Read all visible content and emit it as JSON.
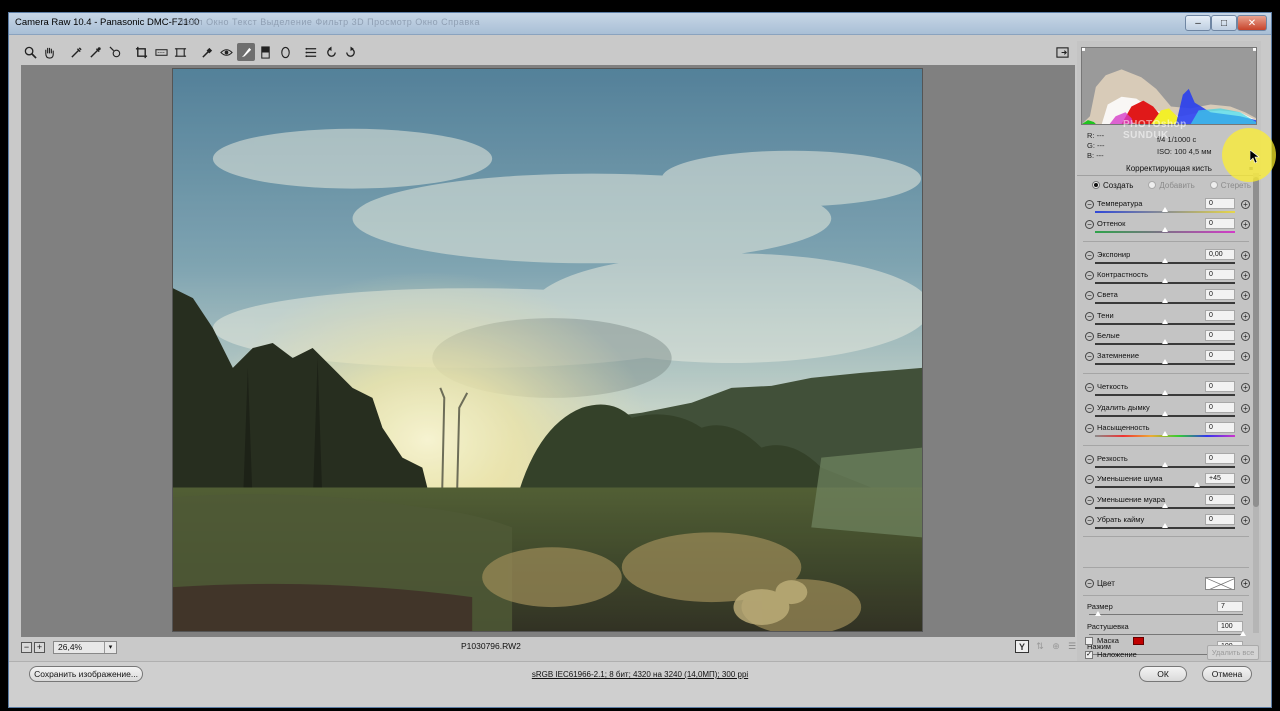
{
  "window": {
    "title": "Camera Raw 10.4  -  Panasonic DMC-FZ100",
    "ghost_menu": "Файл   Окно   Текст   Выделение   Фильтр   3D   Просмотр   Окно   Справка",
    "minimize_label": "–",
    "maximize_label": "□",
    "close_label": "✕"
  },
  "toolbar": {
    "tools": [
      {
        "name": "zoom-icon",
        "glyph": "🔍"
      },
      {
        "name": "hand-icon",
        "glyph": "✋"
      },
      {
        "name": "white-balance-icon",
        "glyph": "✎"
      },
      {
        "name": "color-sampler-icon",
        "glyph": "✎"
      },
      {
        "name": "targeted-adjustment-icon",
        "glyph": "◎"
      },
      {
        "name": "crop-icon",
        "glyph": "⌗"
      },
      {
        "name": "straighten-icon",
        "glyph": "⊟"
      },
      {
        "name": "transform-icon",
        "glyph": "⌸"
      },
      {
        "name": "spot-removal-icon",
        "glyph": "✂"
      },
      {
        "name": "red-eye-icon",
        "glyph": "⊙"
      },
      {
        "name": "adjustment-brush-icon",
        "glyph": "✏"
      },
      {
        "name": "graduated-filter-icon",
        "glyph": "▮"
      },
      {
        "name": "radial-filter-icon",
        "glyph": "◯"
      },
      {
        "name": "preferences-icon",
        "glyph": "☰"
      },
      {
        "name": "rotate-left-icon",
        "glyph": "↺"
      },
      {
        "name": "rotate-right-icon",
        "glyph": "↻"
      }
    ],
    "fullscreen_glyph": "⇱"
  },
  "canvas": {
    "filename": "P1030796.RW2",
    "zoom": "26,4%"
  },
  "histogram": {
    "r_label": "R:",
    "g_label": "G:",
    "b_label": "B:",
    "rgb_values": "---",
    "aperture_shutter": "f/4    1/1000 с",
    "iso_focal": "ISO: 100    4,5 мм",
    "watermark_line1": "PHOTOshop",
    "watermark_line2": "SUNDUK"
  },
  "panel": {
    "title": "Корректирующая кисть",
    "menu_glyph": "≡",
    "modes": [
      {
        "label": "Создать",
        "selected": true
      },
      {
        "label": "Добавить",
        "selected": false
      },
      {
        "label": "Стереть",
        "selected": false
      }
    ],
    "sliders": [
      {
        "label": "Температура",
        "value": "0",
        "pos": 0.5
      },
      {
        "label": "Оттенок",
        "value": "0",
        "pos": 0.5
      },
      {
        "label": "Экспонир",
        "value": "0,00",
        "pos": 0.5
      },
      {
        "label": "Контрастность",
        "value": "0",
        "pos": 0.5
      },
      {
        "label": "Света",
        "value": "0",
        "pos": 0.5
      },
      {
        "label": "Тени",
        "value": "0",
        "pos": 0.5
      },
      {
        "label": "Белые",
        "value": "0",
        "pos": 0.5
      },
      {
        "label": "Затемнение",
        "value": "0",
        "pos": 0.5
      },
      {
        "label": "Четкость",
        "value": "0",
        "pos": 0.5
      },
      {
        "label": "Удалить дымку",
        "value": "0",
        "pos": 0.5
      },
      {
        "label": "Насыщенность",
        "value": "0",
        "pos": 0.5
      },
      {
        "label": "Резкость",
        "value": "0",
        "pos": 0.5
      },
      {
        "label": "Уменьшение шума",
        "value": "+45",
        "pos": 0.725
      },
      {
        "label": "Уменьшение муара",
        "value": "0",
        "pos": 0.5
      },
      {
        "label": "Убрать кайму",
        "value": "0",
        "pos": 0.5
      }
    ],
    "color_label": "Цвет",
    "brush": [
      {
        "label": "Размер",
        "value": "7",
        "pos": 0.06
      },
      {
        "label": "Растушевка",
        "value": "100",
        "pos": 1.0
      },
      {
        "label": "Нажим",
        "value": "100",
        "pos": 1.0
      }
    ],
    "mask_label": "Маска",
    "mask_checked": false,
    "overlay_label": "Наложение",
    "overlay_checked": true,
    "clear_all_label": "Удалить все",
    "mask_color": "#c00000"
  },
  "footer": {
    "save_label": "Сохранить изображение...",
    "workflow_link": "sRGB IEC61966-2.1; 8 бит; 4320 на 3240 (14,0МП); 300 ppi",
    "ok_label": "ОК",
    "cancel_label": "Отмена"
  },
  "colors": {
    "accent_highlight": "#fff028",
    "window_border": "#5c7ea6"
  }
}
